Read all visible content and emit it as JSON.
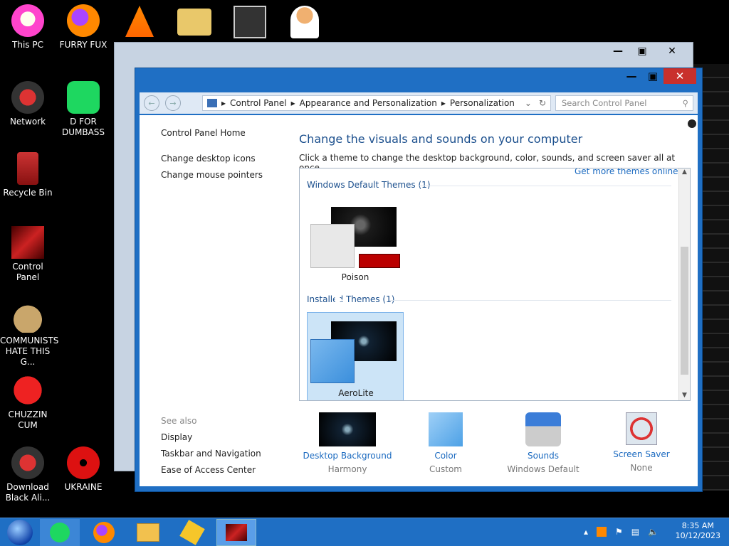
{
  "desktop": {
    "icons": [
      "This PC",
      "FURRY FUX",
      "Network",
      "D FOR DUMBASS",
      "Recycle Bin",
      "Control Panel",
      "COMMUNISTS HATE THIS G...",
      "CHUZZIN CUM",
      "Download Black Ali...",
      "UKRAINE"
    ]
  },
  "window": {
    "address": {
      "crumbs": [
        "Control Panel",
        "Appearance and Personalization",
        "Personalization"
      ],
      "search_placeholder": "Search Control Panel"
    },
    "left_links": [
      "Control Panel Home",
      "Change desktop icons",
      "Change mouse pointers"
    ],
    "see_also": {
      "title": "See also",
      "links": [
        "Display",
        "Taskbar and Navigation",
        "Ease of Access Center"
      ]
    },
    "heading": "Change the visuals and sounds on your computer",
    "subtitle": "Click a theme to change the desktop background, color, sounds, and screen saver all at once.",
    "get_more": "Get more themes online",
    "sections": [
      {
        "title": "Windows Default Themes (1)",
        "theme": "Poison"
      },
      {
        "title": "Installed Themes (1)",
        "theme": "AeroLite"
      }
    ],
    "bottom": [
      {
        "label": "Desktop Background",
        "value": "Harmony"
      },
      {
        "label": "Color",
        "value": "Custom"
      },
      {
        "label": "Sounds",
        "value": "Windows Default"
      },
      {
        "label": "Screen Saver",
        "value": "None"
      }
    ]
  },
  "taskbar": {
    "time": "8:35 AM",
    "date": "10/12/2023"
  },
  "colors": {
    "accent": "#1f6fc4",
    "link": "#1b6ac0",
    "heading": "#1b4f8d"
  }
}
